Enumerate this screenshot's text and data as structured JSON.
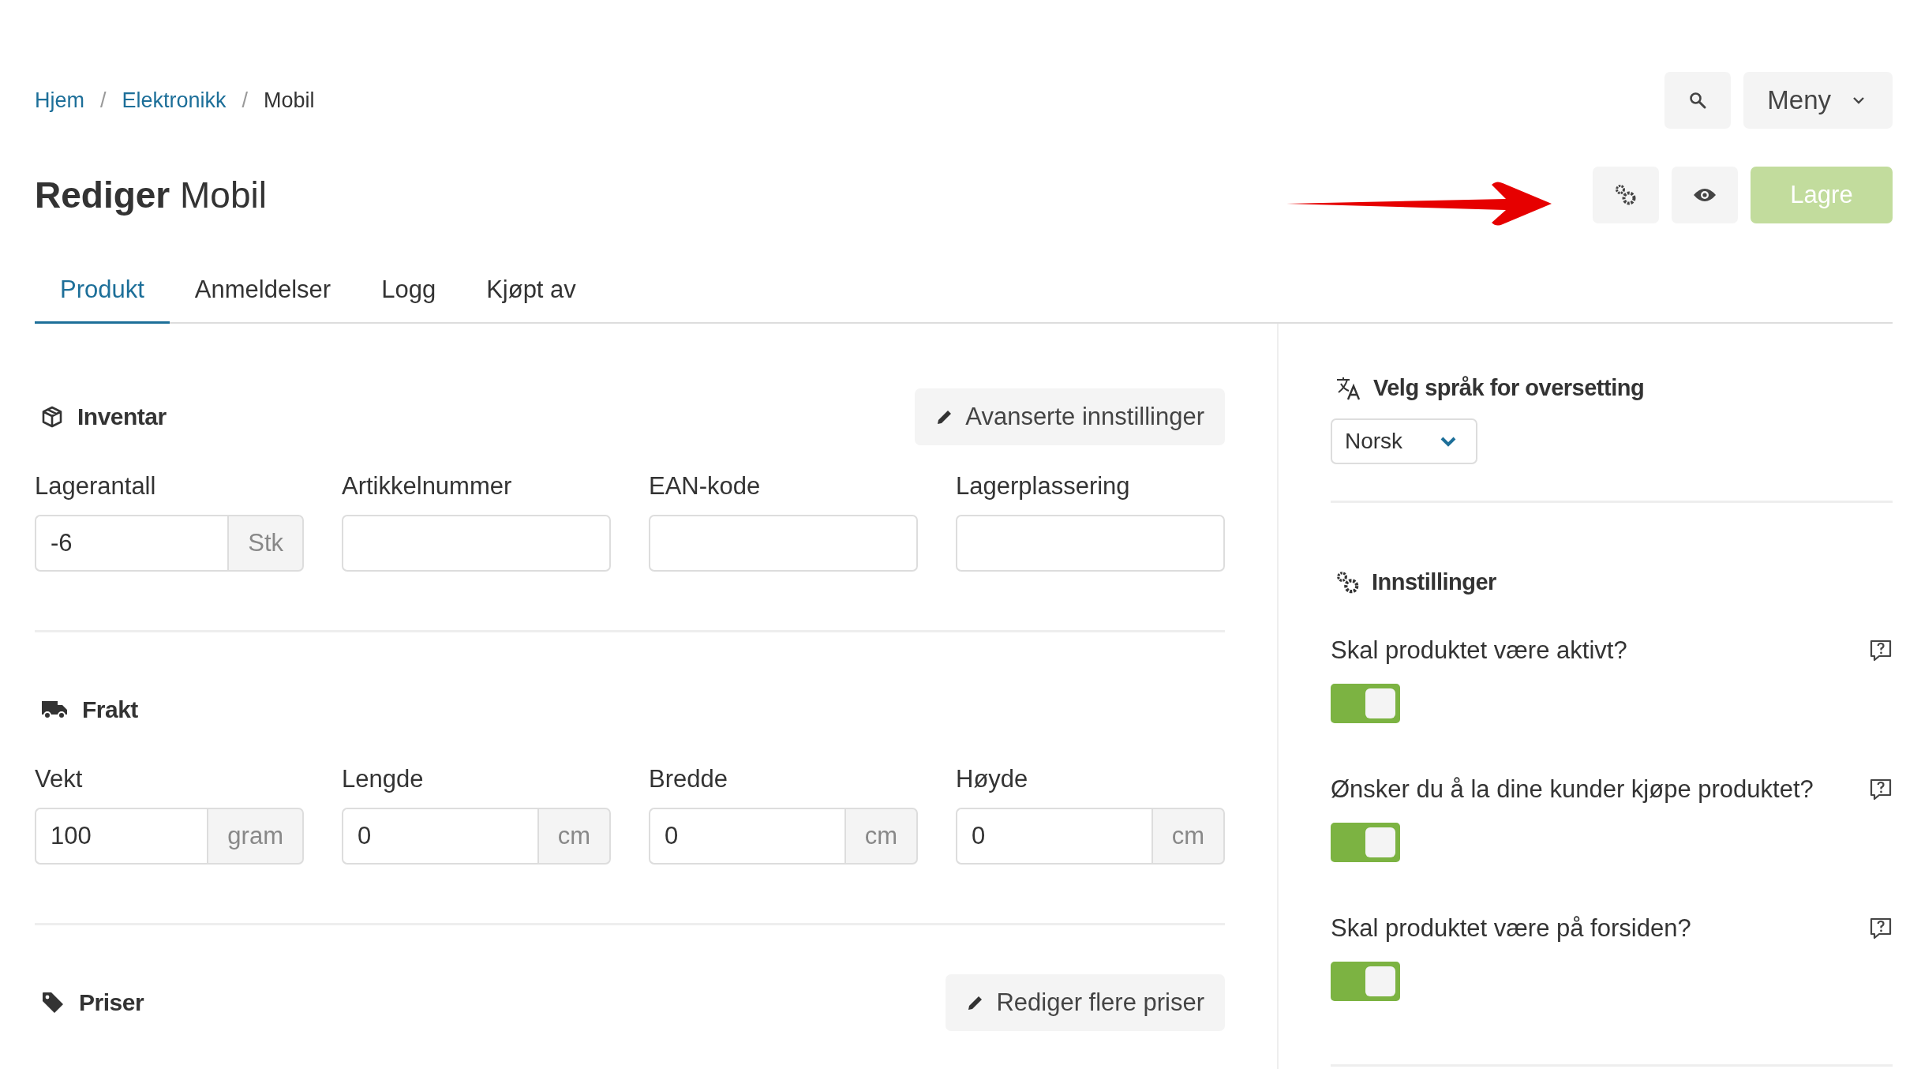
{
  "breadcrumb": {
    "separator": "/",
    "items": [
      {
        "label": "Hjem",
        "current": false
      },
      {
        "label": "Elektronikk",
        "current": false
      },
      {
        "label": "Mobil",
        "current": true
      }
    ]
  },
  "menu": {
    "label": "Meny"
  },
  "title": {
    "action": "Rediger",
    "name": "Mobil"
  },
  "save": {
    "label": "Lagre",
    "disabled": true
  },
  "tabs": [
    {
      "label": "Produkt",
      "selected": true
    },
    {
      "label": "Anmeldelser",
      "selected": false
    },
    {
      "label": "Logg",
      "selected": false
    },
    {
      "label": "Kjøpt av",
      "selected": false
    }
  ],
  "sections": [
    {
      "kind": "inventory",
      "title": "Inventar",
      "action": "Avanserte innstillinger",
      "fields": [
        {
          "label": "Lagerantall",
          "value": "-6",
          "unit": "Stk"
        },
        {
          "label": "Artikkelnummer"
        },
        {
          "label": "EAN-kode"
        },
        {
          "label": "Lagerplassering"
        }
      ]
    },
    {
      "kind": "shipping",
      "title": "Frakt",
      "fields": [
        {
          "label": "Vekt",
          "value": "100",
          "unit": "gram"
        },
        {
          "label": "Lengde",
          "value": "0",
          "unit": "cm"
        },
        {
          "label": "Bredde",
          "value": "0",
          "unit": "cm"
        },
        {
          "label": "Høyde",
          "value": "0",
          "unit": "cm"
        }
      ]
    },
    {
      "kind": "prices",
      "title": "Priser",
      "action": "Rediger flere priser"
    }
  ],
  "translation": {
    "title": "Velg språk for oversetting",
    "language": "Norsk"
  },
  "settings": {
    "title": "Innstillinger",
    "items": [
      {
        "question": "Skal produktet være aktivt?",
        "on": true
      },
      {
        "question": "Ønsker du å la dine kunder kjøpe produktet?",
        "on": true
      },
      {
        "question": "Skal produktet være på forsiden?",
        "on": true
      }
    ]
  }
}
